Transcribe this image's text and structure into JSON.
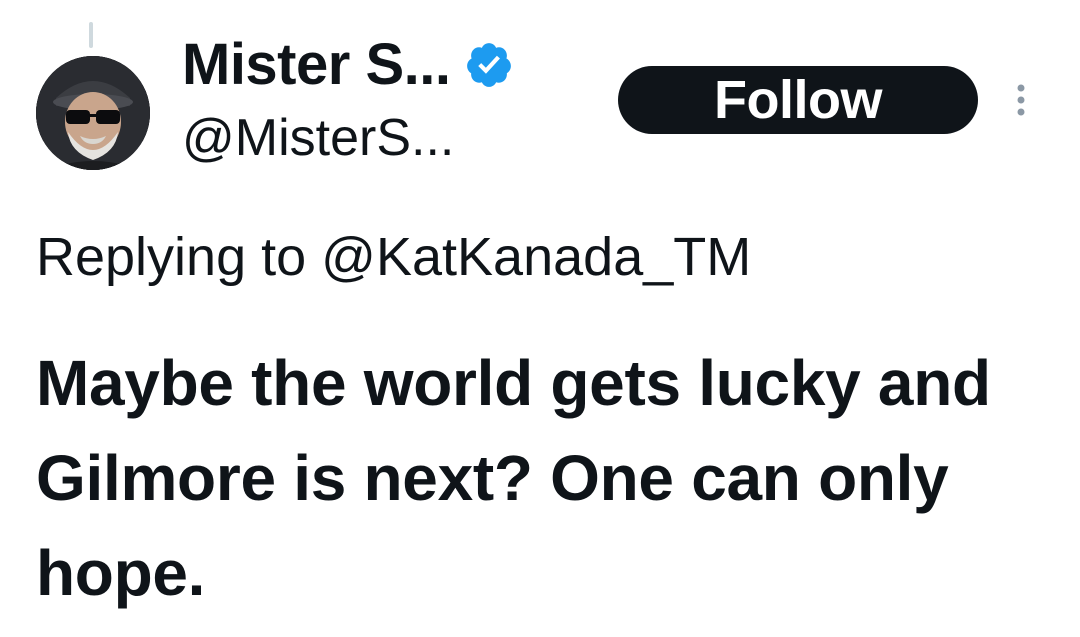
{
  "author": {
    "display_name": "Mister S...",
    "handle": "@MisterS...",
    "avatar_icon": "bearded-man-with-cap-and-sunglasses-photo",
    "verified_icon": "verified-badge-icon",
    "verified_color": "#1d9bf0"
  },
  "actions": {
    "follow_label": "Follow",
    "more_icon": "more-vertical-icon"
  },
  "reply_context": {
    "prefix": "Replying to ",
    "user": "@KatKanada_TM"
  },
  "tweet": {
    "text": "Maybe the world gets lucky and Gilmore is next? One can only hope."
  },
  "colors": {
    "text": "#0f1419",
    "follow_bg": "#0f1419",
    "follow_text": "#ffffff",
    "thread_line": "#cfd9de"
  }
}
